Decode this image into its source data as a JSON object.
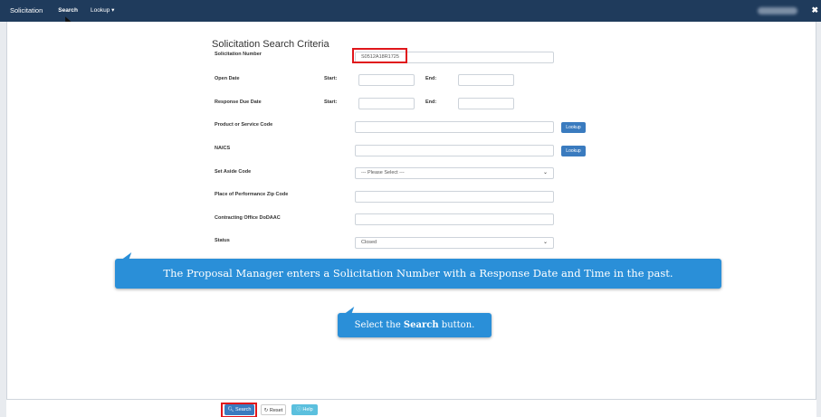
{
  "nav": {
    "brand": "Solicitation",
    "items": [
      "Search",
      "Lookup ▾"
    ],
    "close": "✖"
  },
  "form": {
    "title": "Solicitation Search Criteria",
    "solicitation_number_label": "Solicitation Number",
    "solicitation_number_value": "S0512A18R1725",
    "open_date_label": "Open Date",
    "response_due_date_label": "Response Due Date",
    "start_label": "Start:",
    "end_label": "End:",
    "psc_label": "Product or Service Code",
    "naics_label": "NAICS",
    "lookup_label": "Lookup",
    "set_aside_label": "Set Aside Code",
    "set_aside_value": "--- Please Select ---",
    "pop_zip_label": "Place of Performance Zip Code",
    "dodaac_label": "Contracting Office DoDAAC",
    "status_label": "Status",
    "status_value": "Closed"
  },
  "callouts": {
    "main": "The Proposal Manager enters a Solicitation Number with a Response Date and Time in the past.",
    "step_prefix": "Select the ",
    "step_bold": "Search",
    "step_suffix": " button."
  },
  "footer": {
    "search_label": "Search",
    "reset_label": "Reset",
    "help_label": "Help"
  },
  "colors": {
    "nav_bg": "#1f3b5c",
    "callout_bg": "#2a8fd8",
    "highlight": "#e0161b",
    "primary_button": "#3a7bbf"
  }
}
